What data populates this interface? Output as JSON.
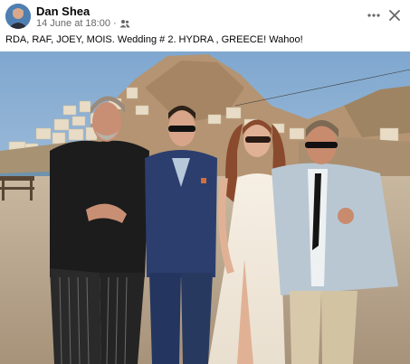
{
  "post": {
    "author": "Dan Shea",
    "timestamp": "14 June at 18:00",
    "separator": "·",
    "audience_icon": "friends-icon",
    "more_icon": "more-horizontal-icon",
    "close_icon": "close-icon",
    "text": "RDA, RAF, JOEY, MOIS. Wedding # 2. HYDRA , GREECE!  Wahoo!",
    "colors": {
      "author_text": "#050505",
      "meta_text": "#65676b",
      "background": "#ffffff"
    }
  }
}
